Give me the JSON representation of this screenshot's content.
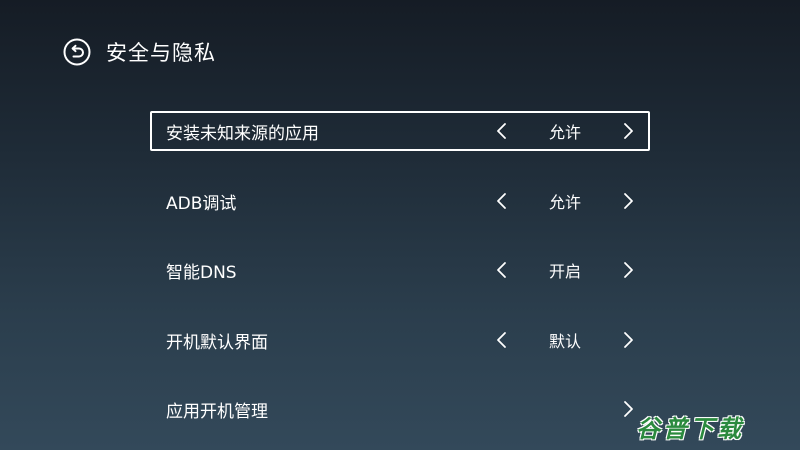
{
  "header": {
    "title": "安全与隐私",
    "back_icon": "back-return-icon"
  },
  "settings": [
    {
      "label": "安装未知来源的应用",
      "value": "允许",
      "selected": true
    },
    {
      "label": "ADB调试",
      "value": "允许",
      "selected": false
    },
    {
      "label": "智能DNS",
      "value": "开启",
      "selected": false
    },
    {
      "label": "开机默认界面",
      "value": "默认",
      "selected": false
    },
    {
      "label": "应用开机管理",
      "value": "",
      "selected": false
    }
  ],
  "watermark": {
    "text": "谷普下载",
    "color": "#2b8a3e"
  },
  "colors": {
    "text": "#ffffff",
    "background_top": "#151c25",
    "background_bottom": "#33495a"
  }
}
